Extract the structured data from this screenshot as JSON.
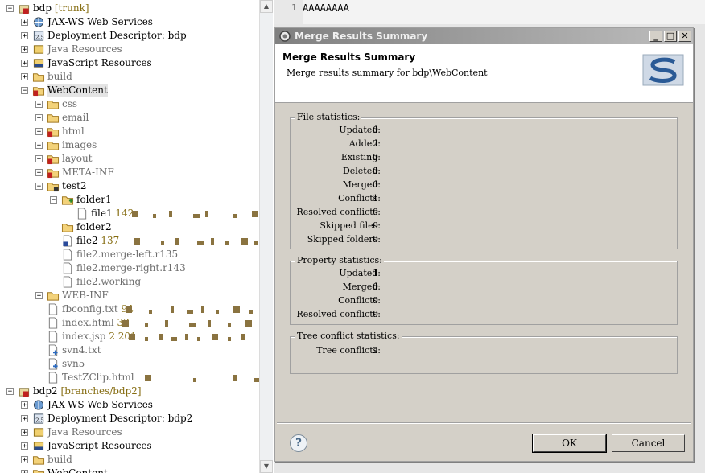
{
  "editor": {
    "line_number": "1",
    "text": "AAAAAAAA"
  },
  "tree": {
    "rows": [
      {
        "label": "bdp",
        "decoration": "[trunk]",
        "icon": "project-icon",
        "expander": "−"
      },
      {
        "label": "JAX-WS Web Services",
        "icon": "webservice-icon",
        "expander": "+"
      },
      {
        "label": "Deployment Descriptor: bdp",
        "icon": "descriptor-icon",
        "expander": "+"
      },
      {
        "label": "Java Resources",
        "icon": "java-resources-icon",
        "expander": "+"
      },
      {
        "label": "JavaScript Resources",
        "icon": "javascript-resources-icon",
        "expander": "+"
      },
      {
        "label": "build",
        "icon": "folder-icon",
        "expander": "+"
      },
      {
        "label": "WebContent",
        "icon": "folder-conflict-icon",
        "expander": "−"
      },
      {
        "label": "css",
        "icon": "folder-icon",
        "expander": "+"
      },
      {
        "label": "email",
        "icon": "folder-icon",
        "expander": "+"
      },
      {
        "label": "html",
        "icon": "folder-conflict-icon",
        "expander": "+"
      },
      {
        "label": "images",
        "icon": "folder-icon",
        "expander": "+"
      },
      {
        "label": "layout",
        "icon": "folder-conflict-icon",
        "expander": "+"
      },
      {
        "label": "META-INF",
        "icon": "folder-conflict-icon",
        "expander": "+"
      },
      {
        "label": "test2",
        "icon": "folder-modified-icon",
        "expander": "−"
      },
      {
        "label": "folder1",
        "icon": "folder-added-icon",
        "expander": "−"
      },
      {
        "label": "file1",
        "decoration": "142",
        "icon": "file-icon"
      },
      {
        "label": "folder2",
        "icon": "folder-icon"
      },
      {
        "label": "file2",
        "decoration": "137",
        "icon": "file-conflict-icon"
      },
      {
        "label": "file2.merge-left.r135",
        "icon": "file-icon"
      },
      {
        "label": "file2.merge-right.r143",
        "icon": "file-icon"
      },
      {
        "label": "file2.working",
        "icon": "file-icon"
      },
      {
        "label": "WEB-INF",
        "icon": "folder-icon",
        "expander": "+"
      },
      {
        "label": "fbconfig.txt",
        "decoration": "94",
        "icon": "file-icon"
      },
      {
        "label": "index.html",
        "decoration": "33",
        "icon": "file-icon"
      },
      {
        "label": "index.jsp",
        "decoration": "2  201",
        "icon": "file-icon"
      },
      {
        "label": "svn4.txt",
        "icon": "file-added-icon"
      },
      {
        "label": "svn5",
        "icon": "file-added-icon"
      },
      {
        "label": "TestZClip.html",
        "icon": "file-icon"
      },
      {
        "label": "bdp2",
        "decoration": "[branches/bdp2]",
        "icon": "project-icon",
        "expander": "−"
      },
      {
        "label": "JAX-WS Web Services",
        "icon": "webservice-icon",
        "expander": "+"
      },
      {
        "label": "Deployment Descriptor: bdp2",
        "icon": "descriptor-icon",
        "expander": "+"
      },
      {
        "label": "Java Resources",
        "icon": "java-resources-icon",
        "expander": "+"
      },
      {
        "label": "JavaScript Resources",
        "icon": "javascript-resources-icon",
        "expander": "+"
      },
      {
        "label": "build",
        "icon": "folder-icon",
        "expander": "+"
      },
      {
        "label": "WebContent",
        "icon": "folder-icon",
        "expander": "+"
      }
    ]
  },
  "dialog": {
    "title": "Merge Results Summary",
    "heading": "Merge Results Summary",
    "subheading": "Merge results summary for bdp\\WebContent",
    "file_stats": {
      "label": "File statistics:",
      "rows": [
        {
          "key": "Updated:",
          "value": "0"
        },
        {
          "key": "Added:",
          "value": "2"
        },
        {
          "key": "Existing:",
          "value": "0"
        },
        {
          "key": "Deleted:",
          "value": "0"
        },
        {
          "key": "Merged:",
          "value": "0"
        },
        {
          "key": "Conflicts:",
          "value": "1"
        },
        {
          "key": "Resolved conflicts:",
          "value": "0"
        },
        {
          "key": "Skipped files:",
          "value": "0"
        },
        {
          "key": "Skipped folders:",
          "value": "0"
        }
      ]
    },
    "property_stats": {
      "label": "Property statistics:",
      "rows": [
        {
          "key": "Updated:",
          "value": "1"
        },
        {
          "key": "Merged:",
          "value": "0"
        },
        {
          "key": "Conflicts:",
          "value": "0"
        },
        {
          "key": "Resolved conflicts:",
          "value": "0"
        }
      ]
    },
    "tree_conflict_stats": {
      "label": "Tree conflict statistics:",
      "rows": [
        {
          "key": "Tree conflicts:",
          "value": "2"
        }
      ]
    },
    "ok_label": "OK",
    "cancel_label": "Cancel",
    "help_glyph": "?",
    "title_buttons": {
      "minimize": "_",
      "maximize": "□",
      "close": "✕"
    }
  }
}
